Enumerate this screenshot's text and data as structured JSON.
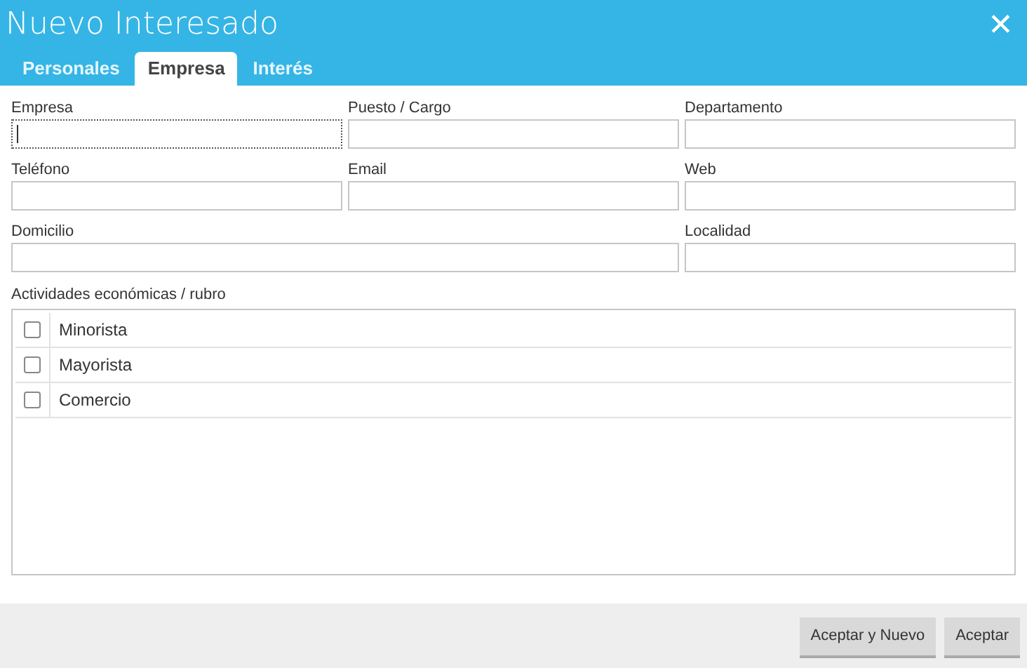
{
  "window": {
    "title": "Nuevo Interesado",
    "close": "✕"
  },
  "tabs": [
    {
      "label": "Personales",
      "selected": false
    },
    {
      "label": "Empresa",
      "selected": true
    },
    {
      "label": "Interés",
      "selected": false
    }
  ],
  "fields": [
    {
      "label": "Empresa",
      "focused": true,
      "wide": false
    },
    {
      "label": "Puesto / Cargo",
      "focused": false,
      "wide": false
    },
    {
      "label": "Departamento",
      "focused": false,
      "wide": false
    },
    {
      "label": "Teléfono",
      "focused": false,
      "wide": false
    },
    {
      "label": "Email",
      "focused": false,
      "wide": false
    },
    {
      "label": "Web",
      "focused": false,
      "wide": false
    },
    {
      "label": "Domicilio",
      "focused": false,
      "wide": true
    },
    {
      "label": "Localidad",
      "focused": false,
      "wide": false
    }
  ],
  "activities": {
    "label": "Actividades económicas / rubro",
    "items": [
      {
        "label": "Minorista",
        "checked": false
      },
      {
        "label": "Mayorista",
        "checked": false
      },
      {
        "label": "Comercio",
        "checked": false
      }
    ]
  },
  "buttons": [
    "Aceptar y Nuevo",
    "Aceptar"
  ]
}
